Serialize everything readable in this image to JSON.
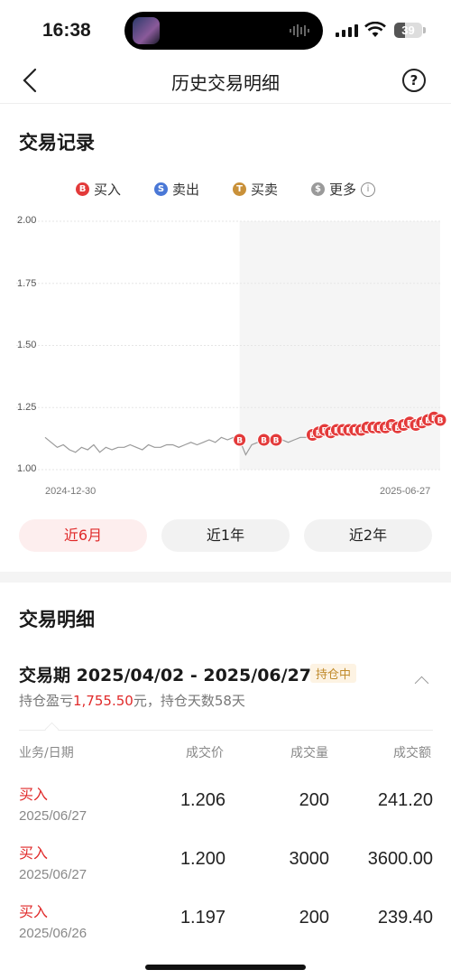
{
  "status_bar": {
    "time": "16:38",
    "battery": "39"
  },
  "nav": {
    "title": "历史交易明细",
    "help_symbol": "?"
  },
  "record": {
    "title": "交易记录",
    "legend": [
      {
        "icon": "B",
        "label": "买入",
        "color": "#e33a3a"
      },
      {
        "icon": "S",
        "label": "卖出",
        "color": "#4a78d6"
      },
      {
        "icon": "T",
        "label": "买卖",
        "color": "#c9913a"
      },
      {
        "icon": "$",
        "label": "更多",
        "color": "#9a9a9a"
      }
    ]
  },
  "chart_data": {
    "type": "line",
    "y_ticks": [
      "2.00",
      "1.75",
      "1.50",
      "1.25",
      "1.00"
    ],
    "ylim": [
      1.0,
      2.0
    ],
    "x_start_label": "2024-12-30",
    "x_end_label": "2025-06-27",
    "series": [
      {
        "values": [
          1.13,
          1.11,
          1.09,
          1.1,
          1.08,
          1.07,
          1.09,
          1.08,
          1.1,
          1.07,
          1.09,
          1.08,
          1.09,
          1.09,
          1.1,
          1.09,
          1.08,
          1.1,
          1.09,
          1.09,
          1.1,
          1.1,
          1.09,
          1.1,
          1.11,
          1.1,
          1.11,
          1.12,
          1.11,
          1.13,
          1.12,
          1.13,
          1.12,
          1.06,
          1.1,
          1.11,
          1.12,
          1.13,
          1.12,
          1.12,
          1.11,
          1.12,
          1.13,
          1.13,
          1.14,
          1.15,
          1.16,
          1.15,
          1.16,
          1.16,
          1.16,
          1.16,
          1.16,
          1.17,
          1.17,
          1.17,
          1.17,
          1.18,
          1.17,
          1.18,
          1.19,
          1.18,
          1.19,
          1.2,
          1.21,
          1.2
        ]
      }
    ],
    "buy_markers": [
      {
        "i": 32,
        "label": "B"
      },
      {
        "i": 36,
        "label": "B"
      },
      {
        "i": 38,
        "label": "B"
      },
      {
        "i": 44,
        "label": "B"
      },
      {
        "i": 45,
        "label": "B"
      },
      {
        "i": 46,
        "label": "B"
      },
      {
        "i": 47,
        "label": "B"
      },
      {
        "i": 48,
        "label": "B"
      },
      {
        "i": 49,
        "label": "B"
      },
      {
        "i": 50,
        "label": "B"
      },
      {
        "i": 51,
        "label": "B"
      },
      {
        "i": 52,
        "label": "B"
      },
      {
        "i": 53,
        "label": "B"
      },
      {
        "i": 54,
        "label": "B"
      },
      {
        "i": 55,
        "label": "B"
      },
      {
        "i": 56,
        "label": "B"
      },
      {
        "i": 57,
        "label": "B"
      },
      {
        "i": 58,
        "label": "B"
      },
      {
        "i": 59,
        "label": "B"
      },
      {
        "i": 60,
        "label": "B"
      },
      {
        "i": 61,
        "label": "B"
      },
      {
        "i": 62,
        "label": "B"
      },
      {
        "i": 63,
        "label": "B"
      },
      {
        "i": 64,
        "label": "B"
      },
      {
        "i": 65,
        "label": "B"
      }
    ],
    "highlight_from_index": 32
  },
  "ranges": [
    {
      "label": "近6月",
      "active": true
    },
    {
      "label": "近1年",
      "active": false
    },
    {
      "label": "近2年",
      "active": false
    }
  ],
  "detail": {
    "title": "交易明细",
    "period": "交易期 2025/04/02 - 2025/06/27",
    "badge": "持仓中",
    "pl_prefix": "持仓盈亏",
    "pl_value": "1,755.50",
    "pl_suffix": "元，持仓天数58天",
    "headers": [
      "业务/日期",
      "成交价",
      "成交量",
      "成交额"
    ],
    "rows": [
      {
        "type": "买入",
        "date": "2025/06/27",
        "price": "1.206",
        "qty": "200",
        "amount": "241.20"
      },
      {
        "type": "买入",
        "date": "2025/06/27",
        "price": "1.200",
        "qty": "3000",
        "amount": "3600.00"
      },
      {
        "type": "买入",
        "date": "2025/06/26",
        "price": "1.197",
        "qty": "200",
        "amount": "239.40"
      }
    ]
  }
}
